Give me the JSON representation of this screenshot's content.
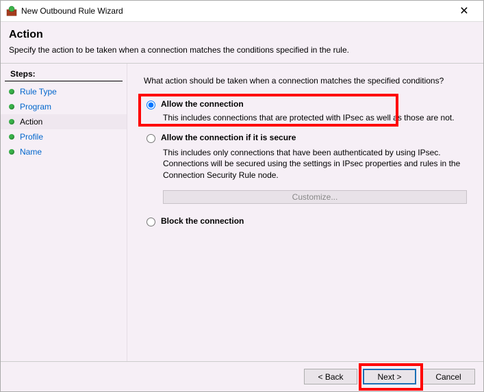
{
  "window": {
    "title": "New Outbound Rule Wizard"
  },
  "header": {
    "title": "Action",
    "subtitle": "Specify the action to be taken when a connection matches the conditions specified in the rule."
  },
  "sidebar": {
    "heading": "Steps:",
    "items": [
      {
        "label": "Rule Type",
        "current": false
      },
      {
        "label": "Program",
        "current": false
      },
      {
        "label": "Action",
        "current": true
      },
      {
        "label": "Profile",
        "current": false
      },
      {
        "label": "Name",
        "current": false
      }
    ]
  },
  "content": {
    "question": "What action should be taken when a connection matches the specified conditions?",
    "options": [
      {
        "value": "allow",
        "label": "Allow the connection",
        "desc": "This includes connections that are protected with IPsec as well as those are not.",
        "selected": true
      },
      {
        "value": "allow_secure",
        "label": "Allow the connection if it is secure",
        "desc": "This includes only connections that have been authenticated by using IPsec.  Connections will be secured using the settings in IPsec properties and rules in the Connection Security Rule node.",
        "selected": false
      },
      {
        "value": "block",
        "label": "Block the connection",
        "desc": "",
        "selected": false
      }
    ],
    "customize_label": "Customize...",
    "customize_enabled": false
  },
  "footer": {
    "back": "< Back",
    "next": "Next >",
    "cancel": "Cancel"
  },
  "highlights": [
    "option-allow",
    "next-button"
  ]
}
